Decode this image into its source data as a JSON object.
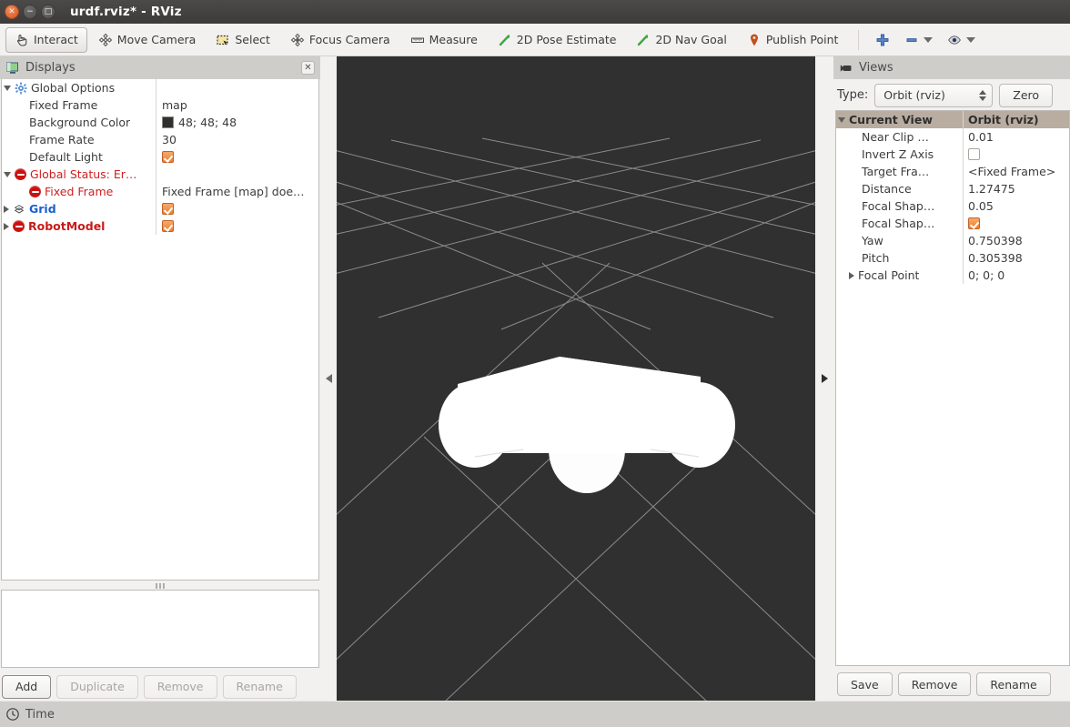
{
  "window": {
    "title": "urdf.rviz* - RViz",
    "buttons": {
      "close": "close-icon",
      "minimize": "minimize-icon",
      "maximize": "maximize-icon"
    }
  },
  "toolbar": {
    "items": [
      {
        "label": "Interact",
        "icon": "hand-cursor-icon",
        "active": true
      },
      {
        "label": "Move Camera",
        "icon": "move-camera-icon",
        "active": false
      },
      {
        "label": "Select",
        "icon": "select-box-icon",
        "active": false
      },
      {
        "label": "Focus Camera",
        "icon": "focus-camera-icon",
        "active": false
      },
      {
        "label": "Measure",
        "icon": "ruler-icon",
        "active": false
      },
      {
        "label": "2D Pose Estimate",
        "icon": "pose-arrow-icon",
        "active": false
      },
      {
        "label": "2D Nav Goal",
        "icon": "nav-goal-arrow-icon",
        "active": false
      },
      {
        "label": "Publish Point",
        "icon": "map-pin-icon",
        "active": false
      }
    ],
    "extras": [
      {
        "icon": "plus-icon",
        "dropdown": false
      },
      {
        "icon": "minus-icon",
        "dropdown": true
      },
      {
        "icon": "eye-icon",
        "dropdown": true
      }
    ]
  },
  "displays_panel": {
    "title": "Displays",
    "title_icon": "display-monitor-icon",
    "close_icon": "panel-close-icon",
    "rows": [
      {
        "indent": 0,
        "expander": "down",
        "icon": "gear-icon",
        "name": "Global Options",
        "style": "normal",
        "value_type": "none",
        "value": ""
      },
      {
        "indent": 1,
        "expander": "none",
        "icon": "none",
        "name": "Fixed Frame",
        "style": "normal",
        "value_type": "text",
        "value": "map"
      },
      {
        "indent": 1,
        "expander": "none",
        "icon": "none",
        "name": "Background Color",
        "style": "normal",
        "value_type": "swatch",
        "value": "48; 48; 48"
      },
      {
        "indent": 1,
        "expander": "none",
        "icon": "none",
        "name": "Frame Rate",
        "style": "normal",
        "value_type": "text",
        "value": "30"
      },
      {
        "indent": 1,
        "expander": "none",
        "icon": "none",
        "name": "Default Light",
        "style": "normal",
        "value_type": "checked",
        "value": ""
      },
      {
        "indent": 0,
        "expander": "down",
        "icon": "error-icon",
        "name": "Global Status: Er…",
        "style": "red",
        "value_type": "none",
        "value": ""
      },
      {
        "indent": 1,
        "expander": "none",
        "icon": "error-icon",
        "name": "Fixed Frame",
        "style": "red",
        "value_type": "text",
        "value": "Fixed Frame [map] doe…"
      },
      {
        "indent": 0,
        "expander": "right",
        "icon": "grid-icon",
        "name": "Grid",
        "style": "blue",
        "value_type": "checked",
        "value": ""
      },
      {
        "indent": 0,
        "expander": "right",
        "icon": "error-icon",
        "name": "RobotModel",
        "style": "redbold",
        "value_type": "checked",
        "value": ""
      }
    ],
    "buttons": [
      {
        "label": "Add",
        "enabled": true
      },
      {
        "label": "Duplicate",
        "enabled": false
      },
      {
        "label": "Remove",
        "enabled": false
      },
      {
        "label": "Rename",
        "enabled": false
      }
    ]
  },
  "views_panel": {
    "title": "Views",
    "title_icon": "camera-icon",
    "type_label": "Type:",
    "type_value": "Orbit (rviz)",
    "zero_button": "Zero",
    "header": {
      "name": "Current View",
      "value": "Orbit (rviz)"
    },
    "rows": [
      {
        "name": "Near Clip …",
        "value": "0.01",
        "value_type": "text",
        "expander": "none"
      },
      {
        "name": "Invert Z Axis",
        "value": "",
        "value_type": "unchecked",
        "expander": "none"
      },
      {
        "name": "Target Fra…",
        "value": "<Fixed Frame>",
        "value_type": "text",
        "expander": "none"
      },
      {
        "name": "Distance",
        "value": "1.27475",
        "value_type": "text",
        "expander": "none"
      },
      {
        "name": "Focal Shap…",
        "value": "0.05",
        "value_type": "text",
        "expander": "none"
      },
      {
        "name": "Focal Shap…",
        "value": "",
        "value_type": "checked",
        "expander": "none"
      },
      {
        "name": "Yaw",
        "value": "0.750398",
        "value_type": "text",
        "expander": "none"
      },
      {
        "name": "Pitch",
        "value": "0.305398",
        "value_type": "text",
        "expander": "none"
      },
      {
        "name": "Focal Point",
        "value": "0; 0; 0",
        "value_type": "text",
        "expander": "right"
      }
    ],
    "buttons": [
      {
        "label": "Save",
        "enabled": true
      },
      {
        "label": "Remove",
        "enabled": true
      },
      {
        "label": "Rename",
        "enabled": true
      }
    ]
  },
  "render_view": {
    "background_color": "#303030",
    "grid_color": "#9b9b9b",
    "robot_color": "#ffffff",
    "splitter_left_icon": "collapse-left-arrow-icon",
    "splitter_right_icon": "collapse-right-arrow-icon"
  },
  "time_panel": {
    "label": "Time",
    "icon": "clock-icon"
  }
}
